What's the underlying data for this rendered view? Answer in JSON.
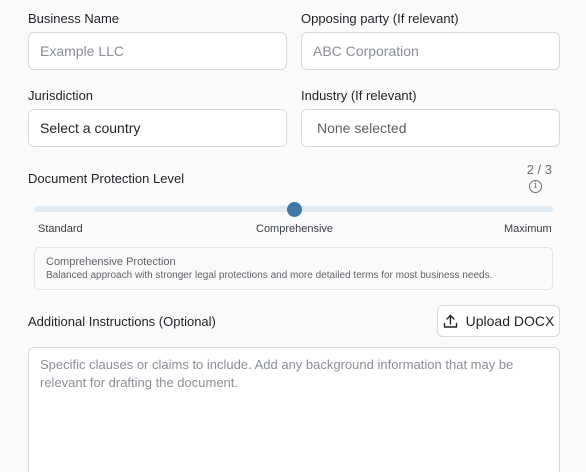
{
  "business_name": {
    "label": "Business Name",
    "placeholder": "Example LLC"
  },
  "opposing_party": {
    "label": "Opposing party (If relevant)",
    "placeholder": "ABC Corporation"
  },
  "jurisdiction": {
    "label": "Jurisdiction",
    "value": "Select a country"
  },
  "industry": {
    "label": "Industry (If relevant)",
    "value": "None selected"
  },
  "protection": {
    "label": "Document Protection Level",
    "counter": "2 / 3",
    "level_index": 2,
    "level_max": 3,
    "ticks": [
      "Standard",
      "Comprehensive",
      "Maximum"
    ],
    "description_title": "Comprehensive Protection",
    "description_text": "Balanced approach with stronger legal protections and more detailed terms for most business needs."
  },
  "additional": {
    "label": "Additional Instructions (Optional)",
    "upload_label": "Upload DOCX",
    "placeholder": "Specific clauses or claims to include. Add any background information that may be relevant for drafting the document."
  },
  "colors": {
    "accent": "#3f78a3",
    "track": "#dfeaf3"
  }
}
